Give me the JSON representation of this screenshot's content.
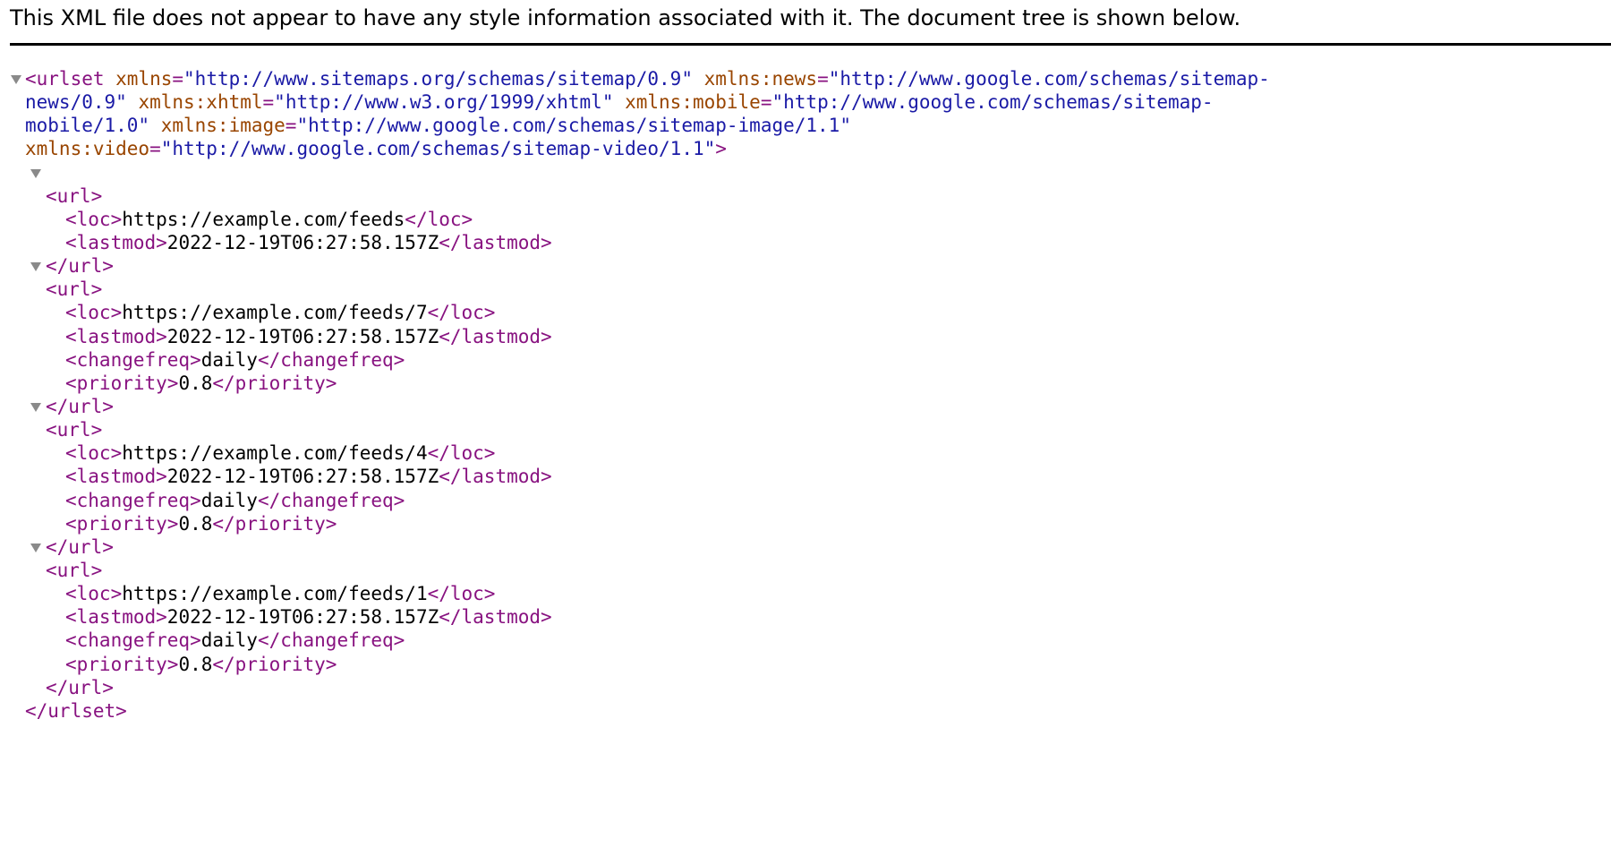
{
  "header": {
    "message": "This XML file does not appear to have any style information associated with it. The document tree is shown below."
  },
  "urlset": {
    "open_line1_a": "<urlset",
    "attr_xmlns_name": " xmlns",
    "eq": "=",
    "attr_xmlns_value": "\"http://www.sitemaps.org/schemas/sitemap/0.9\"",
    "attr_news_name": " xmlns:news",
    "attr_news_value_a": "\"http://www.google.com/schemas/sitemap-",
    "attr_news_value_b": "news/0.9\"",
    "attr_xhtml_name": " xmlns:xhtml",
    "attr_xhtml_value": "\"http://www.w3.org/1999/xhtml\"",
    "attr_mobile_name": " xmlns:mobile",
    "attr_mobile_value_a": "\"http://www.google.com/schemas/sitemap-",
    "attr_mobile_value_b": "mobile/1.0\"",
    "attr_image_name": " xmlns:image",
    "attr_image_value": "\"http://www.google.com/schemas/sitemap-image/1.1\"",
    "attr_video_name": "xmlns:video",
    "attr_video_value": "\"http://www.google.com/schemas/sitemap-video/1.1\"",
    "open_close": ">",
    "close_tag": "</urlset>"
  },
  "tags": {
    "url_open": "<url>",
    "url_close": "</url>",
    "loc_open": "<loc>",
    "loc_close": "</loc>",
    "lastmod_open": "<lastmod>",
    "lastmod_close": "</lastmod>",
    "changefreq_open": "<changefreq>",
    "changefreq_close": "</changefreq>",
    "priority_open": "<priority>",
    "priority_close": "</priority>"
  },
  "urls": [
    {
      "loc": "https://example.com/feeds",
      "lastmod": "2022-12-19T06:27:58.157Z"
    },
    {
      "loc": "https://example.com/feeds/7",
      "lastmod": "2022-12-19T06:27:58.157Z",
      "changefreq": "daily",
      "priority": "0.8"
    },
    {
      "loc": "https://example.com/feeds/4",
      "lastmod": "2022-12-19T06:27:58.157Z",
      "changefreq": "daily",
      "priority": "0.8"
    },
    {
      "loc": "https://example.com/feeds/1",
      "lastmod": "2022-12-19T06:27:58.157Z",
      "changefreq": "daily",
      "priority": "0.8"
    }
  ],
  "colors": {
    "tag": "#881280",
    "attr_name": "#994500",
    "attr_value": "#1a1aa6",
    "text": "#000000",
    "toggle": "#8a8a8a"
  },
  "icons": {
    "collapse_toggle": "triangle-down-icon"
  }
}
